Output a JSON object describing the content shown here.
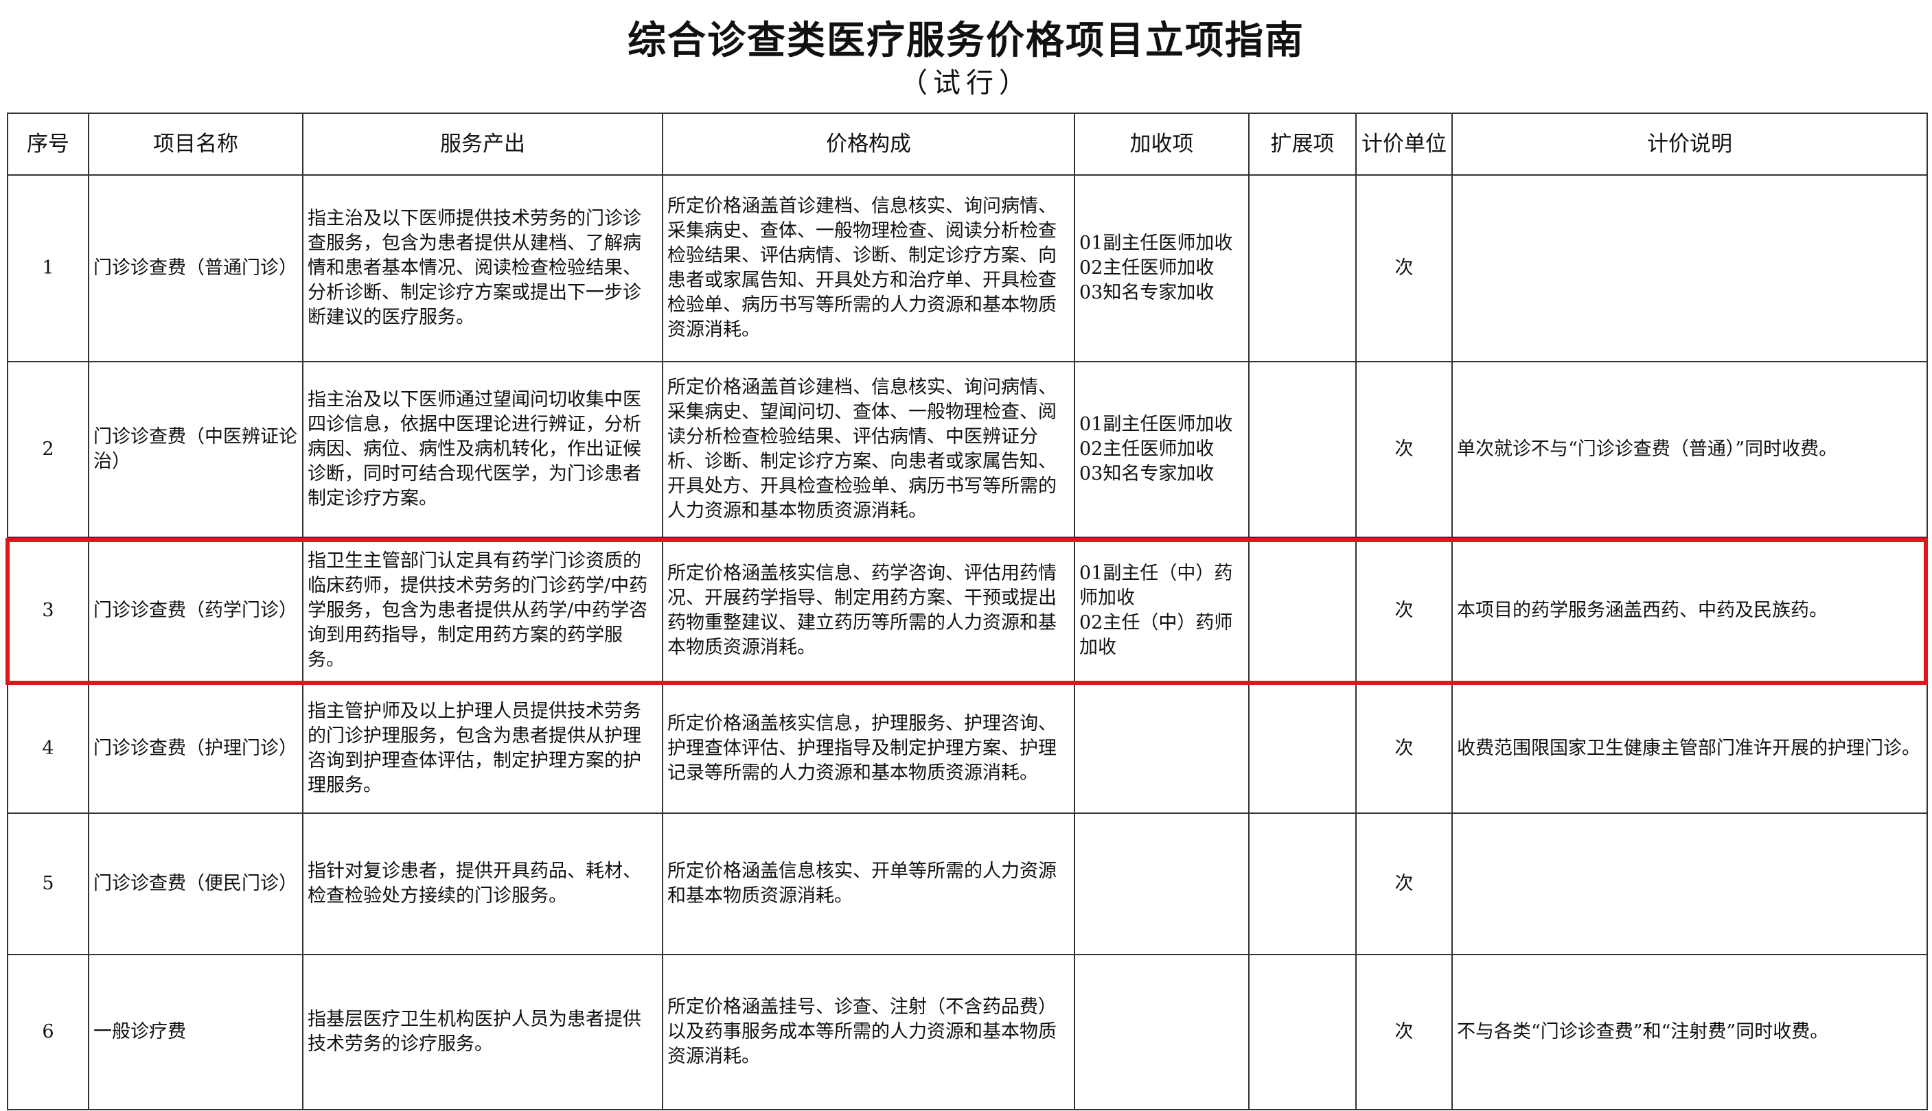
{
  "document": {
    "title": "综合诊查类医疗服务价格项目立项指南",
    "subtitle": "（试行）"
  },
  "table": {
    "headers": [
      "序号",
      "项目名称",
      "服务产出",
      "价格构成",
      "加收项",
      "扩展项",
      "计价单位",
      "计价说明"
    ],
    "rows": [
      {
        "index": "1",
        "name": "门诊诊查费（普通门诊）",
        "output": "指主治及以下医师提供技术劳务的门诊诊查服务，包含为患者提供从建档、了解病情和患者基本情况、阅读检查检验结果、分析诊断、制定诊疗方案或提出下一步诊断建议的医疗服务。",
        "composition": "所定价格涵盖首诊建档、信息核实、询问病情、采集病史、查体、一般物理检查、阅读分析检查检验结果、评估病情、诊断、制定诊疗方案、向患者或家属告知、开具处方和治疗单、开具检查检验单、病历书写等所需的人力资源和基本物质资源消耗。",
        "surcharge": [
          "01副主任医师加收",
          "02主任医师加收",
          "03知名专家加收"
        ],
        "extension": "",
        "unit": "次",
        "note": ""
      },
      {
        "index": "2",
        "name": "门诊诊查费（中医辨证论治）",
        "output": "指主治及以下医师通过望闻问切收集中医四诊信息，依据中医理论进行辨证，分析病因、病位、病性及病机转化，作出证候诊断，同时可结合现代医学，为门诊患者制定诊疗方案。",
        "composition": "所定价格涵盖首诊建档、信息核实、询问病情、采集病史、望闻问切、查体、一般物理检查、阅读分析检查检验结果、评估病情、中医辨证分析、诊断、制定诊疗方案、向患者或家属告知、开具处方、开具检查检验单、病历书写等所需的人力资源和基本物质资源消耗。",
        "surcharge": [
          "01副主任医师加收",
          "02主任医师加收",
          "03知名专家加收"
        ],
        "extension": "",
        "unit": "次",
        "note": "单次就诊不与“门诊诊查费（普通）”同时收费。"
      },
      {
        "index": "3",
        "name": "门诊诊查费（药学门诊）",
        "output": "指卫生主管部门认定具有药学门诊资质的临床药师，提供技术劳务的门诊药学/中药学服务，包含为患者提供从药学/中药学咨询到用药指导，制定用药方案的药学服务。",
        "composition": "所定价格涵盖核实信息、药学咨询、评估用药情况、开展药学指导、制定用药方案、干预或提出药物重整建议、建立药历等所需的人力资源和基本物质资源消耗。",
        "surcharge": [
          "01副主任（中）药师加收",
          "02主任（中）药师加收"
        ],
        "extension": "",
        "unit": "次",
        "note": "本项目的药学服务涵盖西药、中药及民族药。"
      },
      {
        "index": "4",
        "name": "门诊诊查费（护理门诊）",
        "output": "指主管护师及以上护理人员提供技术劳务的门诊护理服务，包含为患者提供从护理咨询到护理查体评估，制定护理方案的护理服务。",
        "composition": "所定价格涵盖核实信息，护理服务、护理咨询、护理查体评估、护理指导及制定护理方案、护理记录等所需的人力资源和基本物质资源消耗。",
        "surcharge": [],
        "extension": "",
        "unit": "次",
        "note": "收费范围限国家卫生健康主管部门准许开展的护理门诊。"
      },
      {
        "index": "5",
        "name": "门诊诊查费（便民门诊）",
        "output": "指针对复诊患者，提供开具药品、耗材、检查检验处方接续的门诊服务。",
        "composition": "所定价格涵盖信息核实、开单等所需的人力资源和基本物质资源消耗。",
        "surcharge": [],
        "extension": "",
        "unit": "次",
        "note": ""
      },
      {
        "index": "6",
        "name": "一般诊疗费",
        "output": "指基层医疗卫生机构医护人员为患者提供技术劳务的诊疗服务。",
        "composition": "所定价格涵盖挂号、诊查、注射（不含药品费）以及药事服务成本等所需的人力资源和基本物质资源消耗。",
        "surcharge": [],
        "extension": "",
        "unit": "次",
        "note": "不与各类“门诊诊查费”和“注射费”同时收费。"
      }
    ]
  },
  "highlight": {
    "row": "3",
    "color": "#e4141b"
  }
}
